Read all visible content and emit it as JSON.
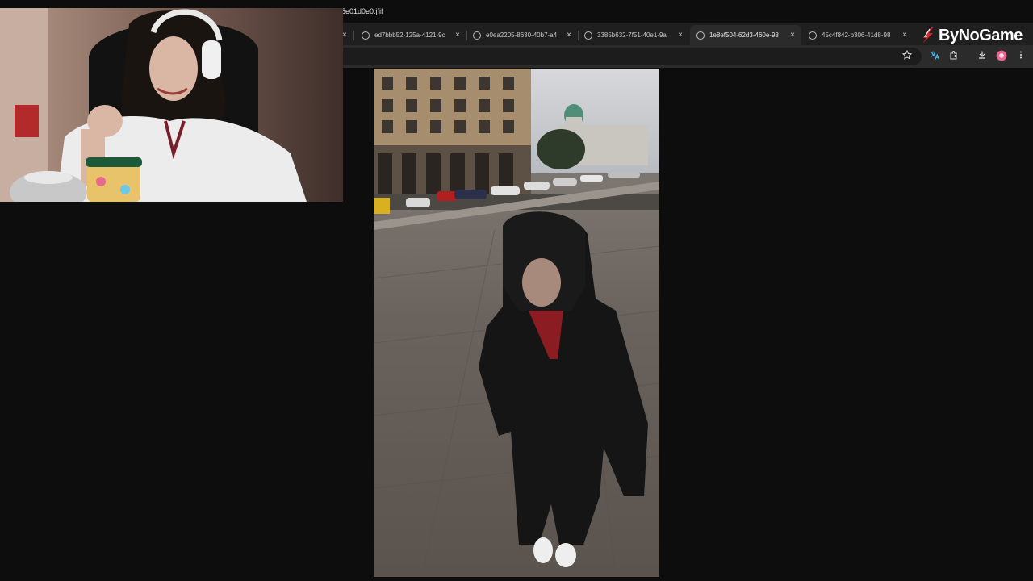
{
  "browser": {
    "tabs": [
      {
        "title": "ed7bbb52-125a-4121-9c",
        "active": false
      },
      {
        "title": "e0ea2205-8630-40b7-a4",
        "active": false
      },
      {
        "title": "3385b632-7f51-40e1-9a",
        "active": false
      },
      {
        "title": "1e8ef504-62d3-460e-98",
        "active": true
      },
      {
        "title": "45c4f842-b306-41d8-98",
        "active": false
      }
    ],
    "close_glyph": "×",
    "url": "5e01d0e0.jfif",
    "toolbar_icons": [
      "star-icon",
      "translate-icon",
      "extensions-icon",
      "download-icon",
      "profile-icon",
      "more-icon"
    ]
  },
  "overlay": {
    "logo_text": "ByNoGame"
  },
  "colors": {
    "background": "#0d0d0d",
    "tabbar": "#1f1f1f",
    "toolbar": "#2b2b2b",
    "logo_accent": "#d62828"
  }
}
